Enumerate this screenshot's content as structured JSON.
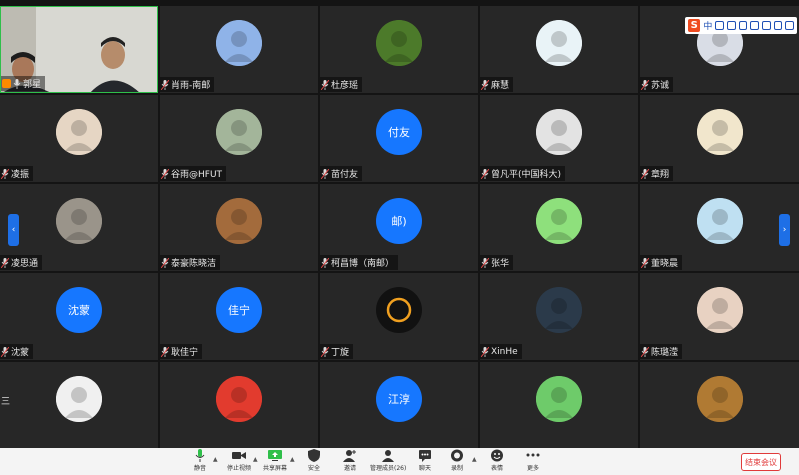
{
  "participants": [
    {
      "name": "郭星",
      "kind": "video",
      "host": true
    },
    {
      "name": "肖雨-南邮",
      "kind": "avatar",
      "color": "#8fb3e8"
    },
    {
      "name": "杜彦瑶",
      "kind": "avatar",
      "color": "#4c7a2a"
    },
    {
      "name": "麻慧",
      "kind": "avatar",
      "color": "#e9f3f7"
    },
    {
      "name": "苏诚",
      "kind": "avatar",
      "color": "#d9dde6"
    },
    {
      "name": "凌振",
      "kind": "avatar",
      "color": "#e6d6c4"
    },
    {
      "name": "谷雨@HFUT",
      "kind": "avatar",
      "color": "#a3b59a"
    },
    {
      "name": "苗付友",
      "kind": "text",
      "text": "付友",
      "color": "#1677ff"
    },
    {
      "name": "曾凡平(中国科大)",
      "kind": "avatar",
      "color": "#e3e3e3"
    },
    {
      "name": "章翔",
      "kind": "avatar",
      "color": "#f1e6cc"
    },
    {
      "name": "凌思通",
      "kind": "avatar",
      "color": "#9a948a"
    },
    {
      "name": "泰豪陈晓洁",
      "kind": "avatar",
      "color": "#a36b3c"
    },
    {
      "name": "柯昌博（南邮）",
      "kind": "text",
      "text": "邮)",
      "color": "#1677ff"
    },
    {
      "name": "张华",
      "kind": "avatar",
      "color": "#8ee07c"
    },
    {
      "name": "董晓晨",
      "kind": "avatar",
      "color": "#bfe0f2"
    },
    {
      "name": "沈蒙",
      "kind": "text",
      "text": "沈蒙",
      "color": "#1677ff"
    },
    {
      "name": "耿佳宁",
      "kind": "text",
      "text": "佳宁",
      "color": "#1677ff"
    },
    {
      "name": "丁旋",
      "kind": "ring",
      "color": "#1a1a1a"
    },
    {
      "name": "XinHe",
      "kind": "avatar",
      "color": "#2b3a4a"
    },
    {
      "name": "陈璐滢",
      "kind": "avatar",
      "color": "#e8d2c2"
    },
    {
      "name": "",
      "kind": "avatar",
      "color": "#f0f0f0"
    },
    {
      "name": "",
      "kind": "avatar",
      "color": "#e23b2e"
    },
    {
      "name": "",
      "kind": "text",
      "text": "江淳",
      "color": "#1677ff"
    },
    {
      "name": "",
      "kind": "avatar",
      "color": "#6ecb6a"
    },
    {
      "name": "",
      "kind": "avatar",
      "color": "#b07a33"
    }
  ],
  "partial_label": "三",
  "ime": {
    "logo": "S",
    "lang": "中"
  },
  "toolbar": {
    "mute": "静音",
    "video": "停止视频",
    "share": "共享屏幕",
    "security": "安全",
    "invite": "邀请",
    "manage": "管理成员(26)",
    "chat": "聊天",
    "record": "录制",
    "reactions": "表情",
    "more": "更多",
    "end": "结束会议"
  },
  "colors": {
    "accent": "#1677ff",
    "end": "#e03a3a",
    "active_border": "#2fbf4a"
  }
}
